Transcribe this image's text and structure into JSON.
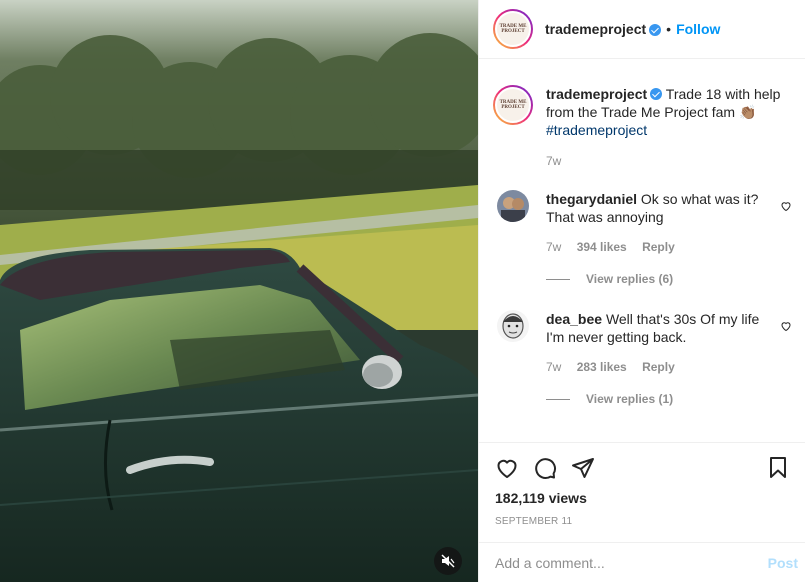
{
  "post": {
    "username": "trademeproject",
    "follow_label": "Follow",
    "separator": "•",
    "logo_text": [
      "TRADE ME",
      "PROJECT"
    ],
    "caption_text": "Trade 18 with help from the Trade Me Project fam",
    "caption_emoji": "👏🏽",
    "hashtag": "#trademeproject",
    "caption_time": "7w"
  },
  "comments": [
    {
      "username": "thegarydaniel",
      "text": "Ok so what was it? That was annoying",
      "time": "7w",
      "likes": "394 likes",
      "reply_label": "Reply",
      "view_replies": "View replies (6)"
    },
    {
      "username": "dea_bee",
      "text": "Well that's 30s Of my life I'm never getting back.",
      "time": "7w",
      "likes": "283 likes",
      "reply_label": "Reply",
      "view_replies": "View replies (1)"
    }
  ],
  "stats": {
    "views": "182,119 views",
    "date": "SEPTEMBER 11"
  },
  "composer": {
    "placeholder": "Add a comment...",
    "post_label": "Post"
  },
  "icons": {
    "mute": "speaker-muted-icon",
    "like": "heart-icon",
    "comment": "comment-bubble-icon",
    "share": "paper-plane-icon",
    "save": "bookmark-icon",
    "comment_like": "heart-icon"
  },
  "colors": {
    "accent": "#0095f6",
    "verified": "#3897f0",
    "hashtag": "#00376b",
    "muted_text": "#8e8e8e",
    "post_disabled": "#b2dffc"
  }
}
